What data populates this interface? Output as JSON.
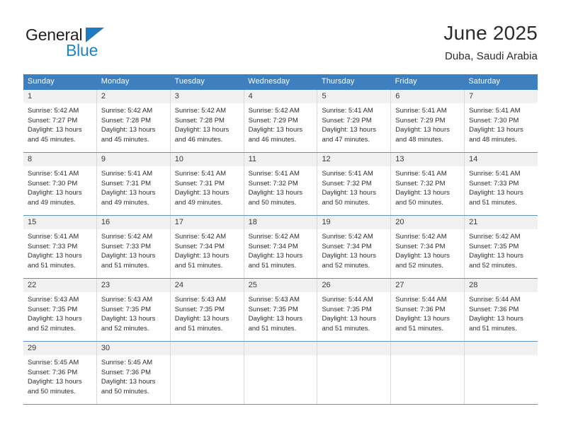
{
  "logo": {
    "word1": "General",
    "word2": "Blue",
    "triangle_color": "#1f7bc1",
    "word2_color": "#2183c9"
  },
  "header": {
    "title": "June 2025",
    "subtitle": "Duba, Saudi Arabia"
  },
  "theme": {
    "header_blue": "#3e7fbf",
    "daynum_gray": "#f1f1f1",
    "grid_line": "#d8d8d8",
    "row_line": "#5f93c9"
  },
  "weekdays": [
    "Sunday",
    "Monday",
    "Tuesday",
    "Wednesday",
    "Thursday",
    "Friday",
    "Saturday"
  ],
  "weeks": [
    [
      {
        "day": "1",
        "sunrise": "Sunrise: 5:42 AM",
        "sunset": "Sunset: 7:27 PM",
        "daylight1": "Daylight: 13 hours",
        "daylight2": "and 45 minutes."
      },
      {
        "day": "2",
        "sunrise": "Sunrise: 5:42 AM",
        "sunset": "Sunset: 7:28 PM",
        "daylight1": "Daylight: 13 hours",
        "daylight2": "and 45 minutes."
      },
      {
        "day": "3",
        "sunrise": "Sunrise: 5:42 AM",
        "sunset": "Sunset: 7:28 PM",
        "daylight1": "Daylight: 13 hours",
        "daylight2": "and 46 minutes."
      },
      {
        "day": "4",
        "sunrise": "Sunrise: 5:42 AM",
        "sunset": "Sunset: 7:29 PM",
        "daylight1": "Daylight: 13 hours",
        "daylight2": "and 46 minutes."
      },
      {
        "day": "5",
        "sunrise": "Sunrise: 5:41 AM",
        "sunset": "Sunset: 7:29 PM",
        "daylight1": "Daylight: 13 hours",
        "daylight2": "and 47 minutes."
      },
      {
        "day": "6",
        "sunrise": "Sunrise: 5:41 AM",
        "sunset": "Sunset: 7:29 PM",
        "daylight1": "Daylight: 13 hours",
        "daylight2": "and 48 minutes."
      },
      {
        "day": "7",
        "sunrise": "Sunrise: 5:41 AM",
        "sunset": "Sunset: 7:30 PM",
        "daylight1": "Daylight: 13 hours",
        "daylight2": "and 48 minutes."
      }
    ],
    [
      {
        "day": "8",
        "sunrise": "Sunrise: 5:41 AM",
        "sunset": "Sunset: 7:30 PM",
        "daylight1": "Daylight: 13 hours",
        "daylight2": "and 49 minutes."
      },
      {
        "day": "9",
        "sunrise": "Sunrise: 5:41 AM",
        "sunset": "Sunset: 7:31 PM",
        "daylight1": "Daylight: 13 hours",
        "daylight2": "and 49 minutes."
      },
      {
        "day": "10",
        "sunrise": "Sunrise: 5:41 AM",
        "sunset": "Sunset: 7:31 PM",
        "daylight1": "Daylight: 13 hours",
        "daylight2": "and 49 minutes."
      },
      {
        "day": "11",
        "sunrise": "Sunrise: 5:41 AM",
        "sunset": "Sunset: 7:32 PM",
        "daylight1": "Daylight: 13 hours",
        "daylight2": "and 50 minutes."
      },
      {
        "day": "12",
        "sunrise": "Sunrise: 5:41 AM",
        "sunset": "Sunset: 7:32 PM",
        "daylight1": "Daylight: 13 hours",
        "daylight2": "and 50 minutes."
      },
      {
        "day": "13",
        "sunrise": "Sunrise: 5:41 AM",
        "sunset": "Sunset: 7:32 PM",
        "daylight1": "Daylight: 13 hours",
        "daylight2": "and 50 minutes."
      },
      {
        "day": "14",
        "sunrise": "Sunrise: 5:41 AM",
        "sunset": "Sunset: 7:33 PM",
        "daylight1": "Daylight: 13 hours",
        "daylight2": "and 51 minutes."
      }
    ],
    [
      {
        "day": "15",
        "sunrise": "Sunrise: 5:41 AM",
        "sunset": "Sunset: 7:33 PM",
        "daylight1": "Daylight: 13 hours",
        "daylight2": "and 51 minutes."
      },
      {
        "day": "16",
        "sunrise": "Sunrise: 5:42 AM",
        "sunset": "Sunset: 7:33 PM",
        "daylight1": "Daylight: 13 hours",
        "daylight2": "and 51 minutes."
      },
      {
        "day": "17",
        "sunrise": "Sunrise: 5:42 AM",
        "sunset": "Sunset: 7:34 PM",
        "daylight1": "Daylight: 13 hours",
        "daylight2": "and 51 minutes."
      },
      {
        "day": "18",
        "sunrise": "Sunrise: 5:42 AM",
        "sunset": "Sunset: 7:34 PM",
        "daylight1": "Daylight: 13 hours",
        "daylight2": "and 51 minutes."
      },
      {
        "day": "19",
        "sunrise": "Sunrise: 5:42 AM",
        "sunset": "Sunset: 7:34 PM",
        "daylight1": "Daylight: 13 hours",
        "daylight2": "and 52 minutes."
      },
      {
        "day": "20",
        "sunrise": "Sunrise: 5:42 AM",
        "sunset": "Sunset: 7:34 PM",
        "daylight1": "Daylight: 13 hours",
        "daylight2": "and 52 minutes."
      },
      {
        "day": "21",
        "sunrise": "Sunrise: 5:42 AM",
        "sunset": "Sunset: 7:35 PM",
        "daylight1": "Daylight: 13 hours",
        "daylight2": "and 52 minutes."
      }
    ],
    [
      {
        "day": "22",
        "sunrise": "Sunrise: 5:43 AM",
        "sunset": "Sunset: 7:35 PM",
        "daylight1": "Daylight: 13 hours",
        "daylight2": "and 52 minutes."
      },
      {
        "day": "23",
        "sunrise": "Sunrise: 5:43 AM",
        "sunset": "Sunset: 7:35 PM",
        "daylight1": "Daylight: 13 hours",
        "daylight2": "and 52 minutes."
      },
      {
        "day": "24",
        "sunrise": "Sunrise: 5:43 AM",
        "sunset": "Sunset: 7:35 PM",
        "daylight1": "Daylight: 13 hours",
        "daylight2": "and 51 minutes."
      },
      {
        "day": "25",
        "sunrise": "Sunrise: 5:43 AM",
        "sunset": "Sunset: 7:35 PM",
        "daylight1": "Daylight: 13 hours",
        "daylight2": "and 51 minutes."
      },
      {
        "day": "26",
        "sunrise": "Sunrise: 5:44 AM",
        "sunset": "Sunset: 7:35 PM",
        "daylight1": "Daylight: 13 hours",
        "daylight2": "and 51 minutes."
      },
      {
        "day": "27",
        "sunrise": "Sunrise: 5:44 AM",
        "sunset": "Sunset: 7:36 PM",
        "daylight1": "Daylight: 13 hours",
        "daylight2": "and 51 minutes."
      },
      {
        "day": "28",
        "sunrise": "Sunrise: 5:44 AM",
        "sunset": "Sunset: 7:36 PM",
        "daylight1": "Daylight: 13 hours",
        "daylight2": "and 51 minutes."
      }
    ],
    [
      {
        "day": "29",
        "sunrise": "Sunrise: 5:45 AM",
        "sunset": "Sunset: 7:36 PM",
        "daylight1": "Daylight: 13 hours",
        "daylight2": "and 50 minutes."
      },
      {
        "day": "30",
        "sunrise": "Sunrise: 5:45 AM",
        "sunset": "Sunset: 7:36 PM",
        "daylight1": "Daylight: 13 hours",
        "daylight2": "and 50 minutes."
      },
      {
        "day": "",
        "sunrise": "",
        "sunset": "",
        "daylight1": "",
        "daylight2": ""
      },
      {
        "day": "",
        "sunrise": "",
        "sunset": "",
        "daylight1": "",
        "daylight2": ""
      },
      {
        "day": "",
        "sunrise": "",
        "sunset": "",
        "daylight1": "",
        "daylight2": ""
      },
      {
        "day": "",
        "sunrise": "",
        "sunset": "",
        "daylight1": "",
        "daylight2": ""
      },
      {
        "day": "",
        "sunrise": "",
        "sunset": "",
        "daylight1": "",
        "daylight2": ""
      }
    ]
  ]
}
